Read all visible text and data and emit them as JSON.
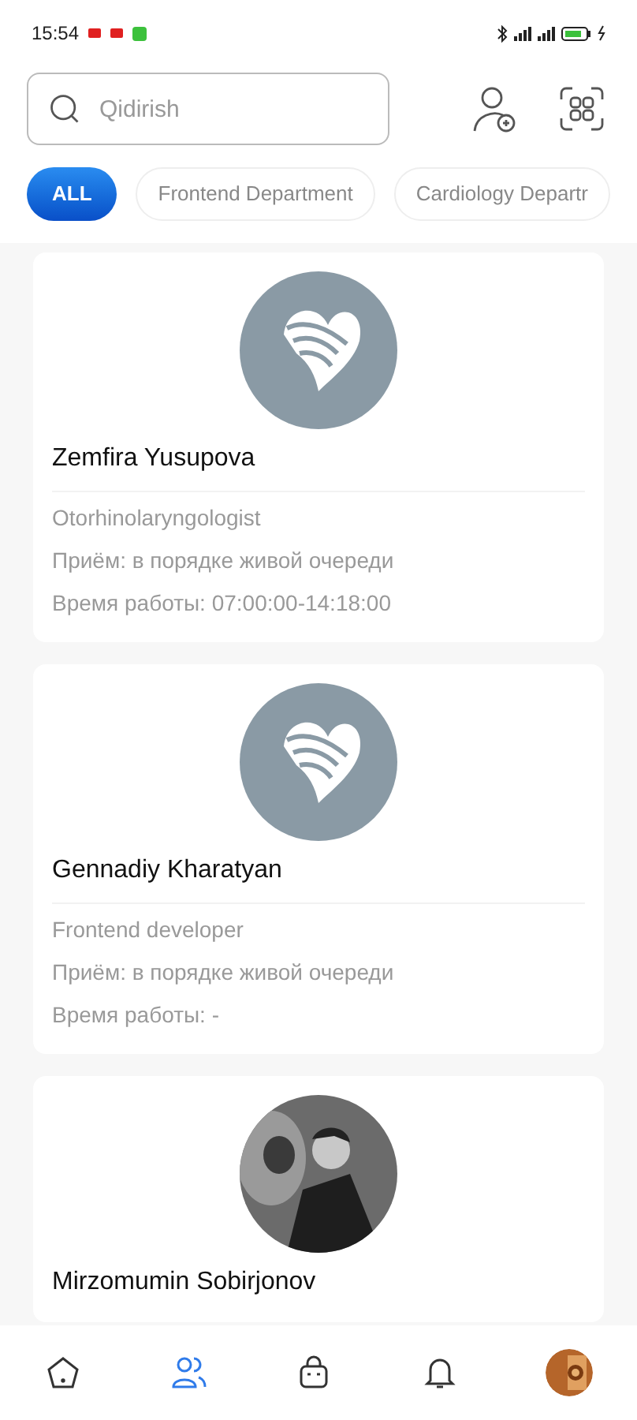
{
  "status_bar": {
    "time": "15:54"
  },
  "search": {
    "placeholder": "Qidirish"
  },
  "filters": [
    {
      "label": "ALL",
      "selected": true
    },
    {
      "label": "Frontend Department",
      "selected": false
    },
    {
      "label": "Cardiology Departr",
      "selected": false
    }
  ],
  "doctors": [
    {
      "kind": "logo",
      "name": "Zemfira Yusupova",
      "specialty": "Otorhinolaryngologist",
      "reception": "Приём: в порядке живой очереди",
      "hours": "Время работы: 07:00:00-14:18:00"
    },
    {
      "kind": "logo",
      "name": "Gennadiy Kharatyan",
      "specialty": "Frontend developer",
      "reception": "Приём: в порядке живой очереди",
      "hours": "Время работы: -"
    },
    {
      "kind": "picture",
      "name": "Mirzomumin Sobirjonov"
    }
  ],
  "bottom_nav": [
    {
      "kind": "home",
      "selected": false
    },
    {
      "kind": "people",
      "selected": true
    },
    {
      "kind": "bag",
      "selected": false
    },
    {
      "kind": "bell",
      "selected": false
    },
    {
      "kind": "profile",
      "selected": false
    }
  ]
}
